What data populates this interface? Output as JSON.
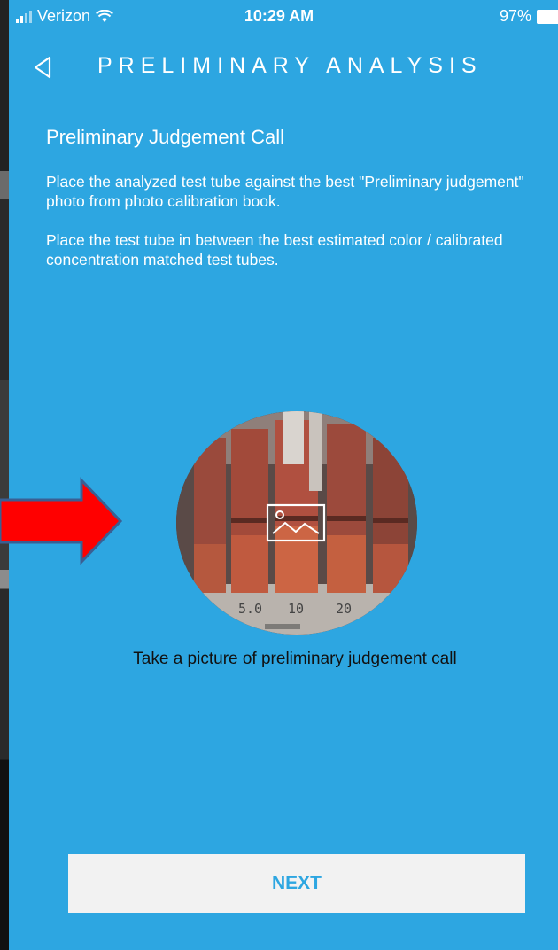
{
  "statusbar": {
    "carrier": "Verizon",
    "time": "10:29 AM",
    "battery": "97%"
  },
  "navbar": {
    "title": "PRELIMINARY ANALYSIS",
    "back_icon": "back-triangle-icon"
  },
  "content": {
    "section_title": "Preliminary Judgement Call",
    "paragraph1": "Place the analyzed test tube against the best \"Preliminary judgement\" photo from photo calibration book.",
    "paragraph2": "Place the test tube in between the best estimated color / calibrated concentration matched test tubes.",
    "photo_labels": [
      "5.0",
      "10",
      "20"
    ],
    "image_icon": "image-placeholder-icon",
    "caption": "Take a picture of preliminary judgement call"
  },
  "next_button": {
    "label": "NEXT"
  },
  "colors": {
    "background": "#2da6e1",
    "arrow": "#ff0000",
    "arrow_border": "#3a5f93",
    "button_bg": "#f2f2f2"
  }
}
